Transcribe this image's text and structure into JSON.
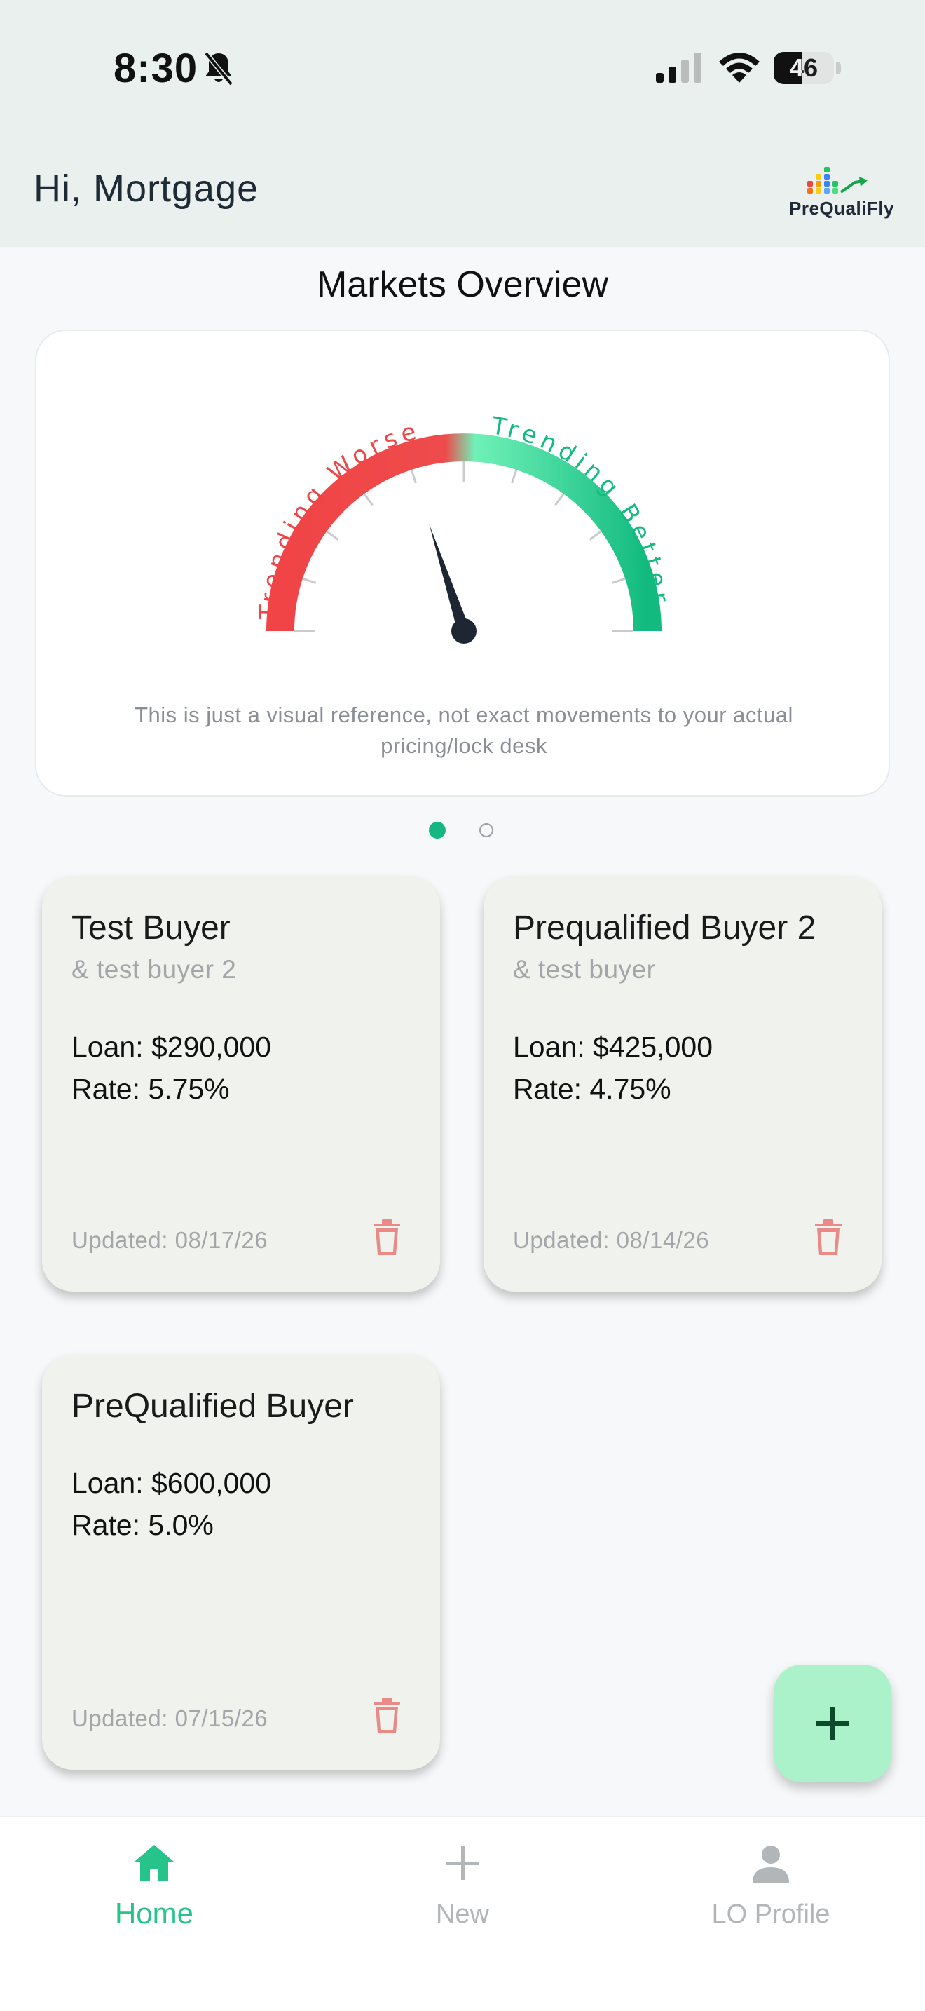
{
  "status_bar": {
    "time": "8:30",
    "battery": "46",
    "battery_level": 0.46
  },
  "header": {
    "greeting": "Hi, Mortgage",
    "logo_text": "PreQualiFly"
  },
  "markets": {
    "title": "Markets Overview",
    "gauge": {
      "worse_label": "Trending Worse",
      "better_label": "Trending Better",
      "needle_position": 0.4,
      "worse_color": "#f04446",
      "better_color": "#12ba7f"
    },
    "note": "This is just a visual reference, not exact movements to your actual pricing/lock desk",
    "page_dots": 2,
    "active_dot": 0
  },
  "buyers": [
    {
      "name": "Test Buyer",
      "co_buyer": "& test buyer 2",
      "loan": "Loan: $290,000",
      "rate": "Rate: 5.75%",
      "updated": "Updated: 08/17/26"
    },
    {
      "name": "Prequalified Buyer 2",
      "co_buyer": "& test buyer",
      "loan": "Loan: $425,000",
      "rate": "Rate: 4.75%",
      "updated": "Updated: 08/14/26"
    },
    {
      "name": "PreQualified Buyer",
      "co_buyer": "",
      "loan": "Loan: $600,000",
      "rate": "Rate: 5.0%",
      "updated": "Updated: 07/15/26"
    }
  ],
  "fab": {
    "icon": "plus-icon"
  },
  "nav": {
    "home": "Home",
    "new": "New",
    "profile": "LO Profile"
  },
  "colors": {
    "accent": "#16b681",
    "card_bg": "#eff2ed",
    "trash": "#e98a87",
    "fab_bg": "#abf2cb"
  }
}
